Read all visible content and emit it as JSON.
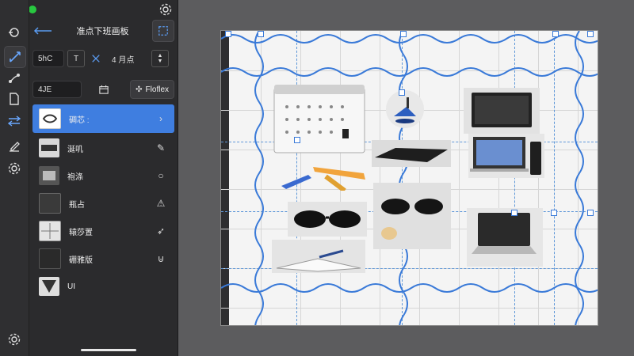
{
  "window": {
    "title": "准点下班画板",
    "traffic_lights": [
      "#ff5f57",
      "#febc2e",
      "#28c840"
    ],
    "settings_icon": "gear-icon"
  },
  "rail": {
    "items": [
      {
        "icon": "grid-icon",
        "active": false
      },
      {
        "icon": "pen-path-icon",
        "active": true
      },
      {
        "icon": "node-branch-icon",
        "active": false
      },
      {
        "icon": "document-icon",
        "active": false
      },
      {
        "icon": "move-arrows-icon",
        "active": false
      },
      {
        "icon": "edit-icon",
        "active": false
      },
      {
        "icon": "settings-icon",
        "active": false
      }
    ],
    "bottom_icon": "gear-icon"
  },
  "header": {
    "back_icon": "back-arrow-icon",
    "title": "准点下班画板",
    "frame_icon": "selection-frame-icon"
  },
  "toolbar": {
    "size_value": "5hC",
    "type_label": "T",
    "move_icon": "cross-arrows-icon",
    "step_label": "4 月点"
  },
  "search": {
    "value": "4JE",
    "calendar_icon": "calendar-icon",
    "properties_label": "Floflex"
  },
  "layers": [
    {
      "label": "碉芯 :",
      "trailing": "chevron-right-icon",
      "selected": true
    },
    {
      "label": "涎叽",
      "trailing": "brush-icon",
      "selected": false
    },
    {
      "label": "袍涤",
      "trailing": "circle-icon",
      "selected": false
    },
    {
      "label": "瓶占",
      "trailing": "warning-icon",
      "selected": false
    },
    {
      "label": "辕莎置",
      "trailing": "pin-icon",
      "selected": false
    },
    {
      "label": "硼雅版",
      "trailing": "magnet-icon",
      "selected": false
    },
    {
      "label": "UI",
      "trailing": "",
      "selected": false
    }
  ],
  "accent_color": "#3f7ee0",
  "guide_color": "#3a7ad8"
}
